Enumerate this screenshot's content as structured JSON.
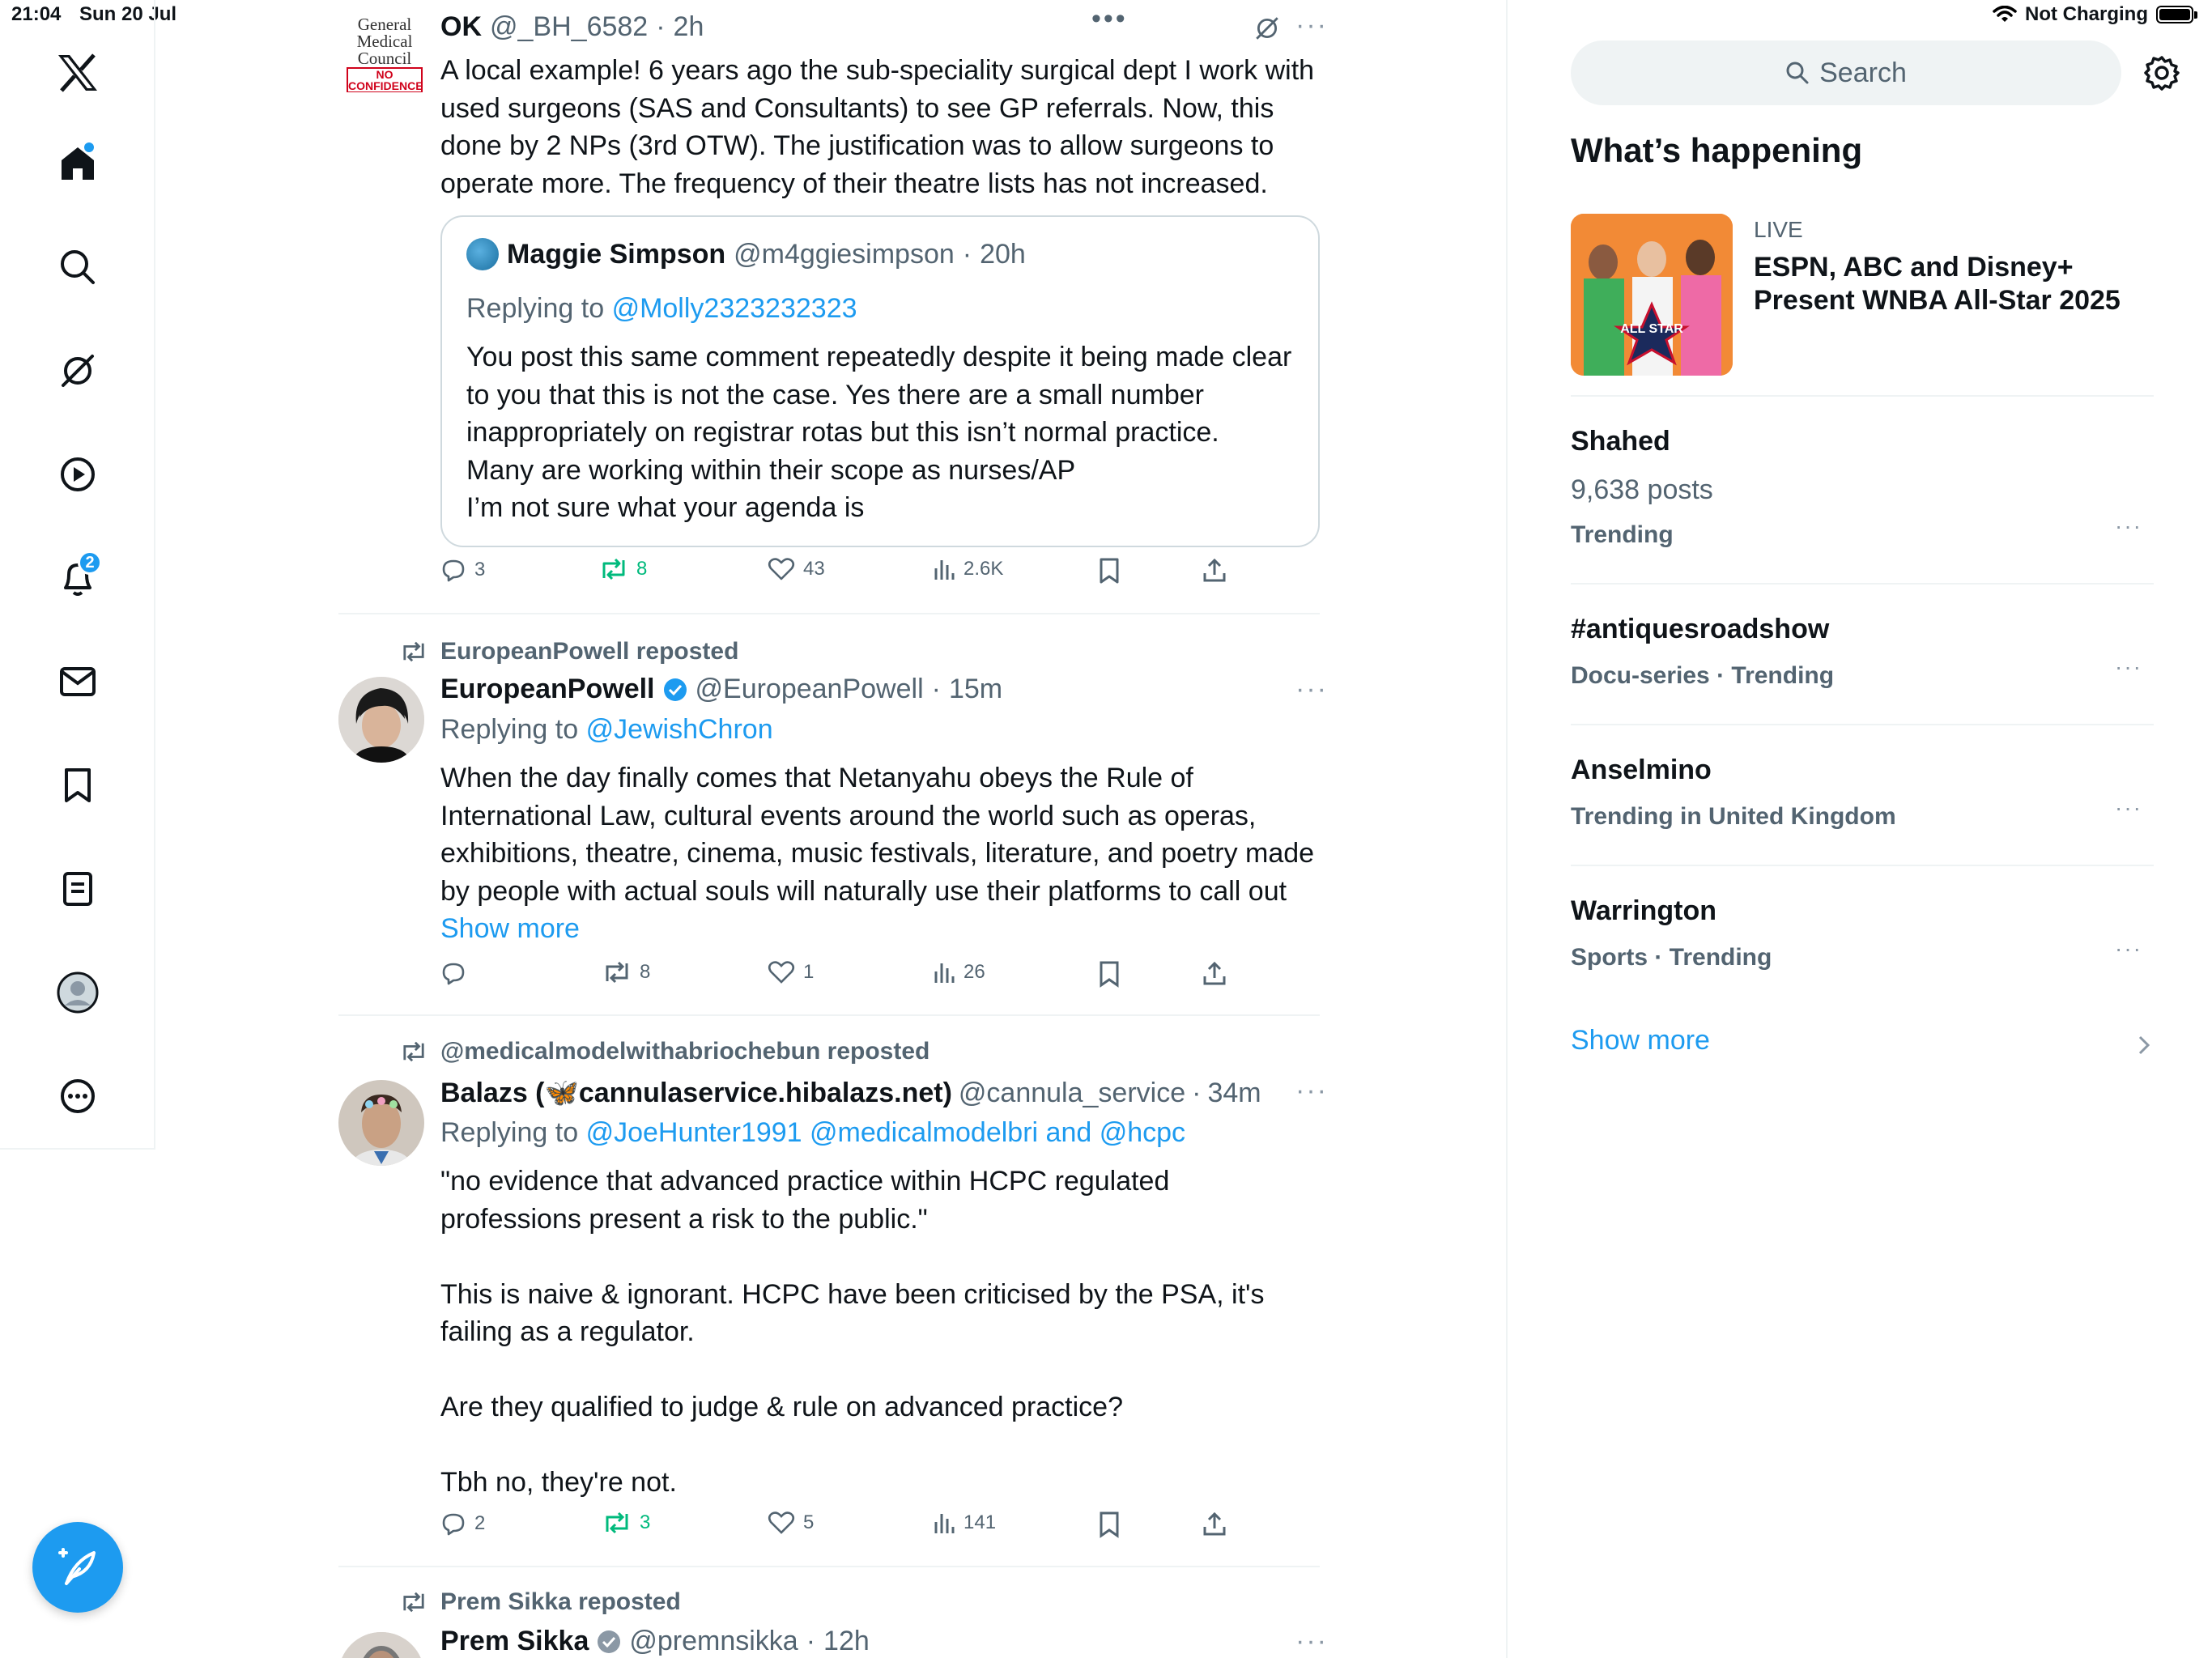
{
  "status_bar": {
    "time": "21:04",
    "date": "Sun 20 Jul",
    "charging": "Not Charging"
  },
  "sidebar": {
    "notifications_badge": "2",
    "items": [
      "x-logo",
      "home",
      "search",
      "grok",
      "videos",
      "notifications",
      "messages",
      "bookmarks",
      "lists",
      "profile",
      "more"
    ]
  },
  "tweets": [
    {
      "name": "OK",
      "handle": "@_BH_6582",
      "time": "2h",
      "avatar_text": {
        "l1": "General",
        "l2": "Medical",
        "l3": "Council",
        "l4": "NO",
        "l5": "CONFIDENCE"
      },
      "text": "A local example! 6 years ago the sub-speciality surgical dept I work with used surgeons (SAS and Consultants) to see GP referrals. Now, this done by 2 NPs (3rd OTW). The justification was to allow surgeons to operate more. The frequency of their theatre lists has not increased.",
      "quote": {
        "name": "Maggie Simpson",
        "handle": "@m4ggiesimpson",
        "time": "20h",
        "replying_prefix": "Replying to",
        "replying_to": "@Molly2323232323",
        "text": "You post this same comment repeatedly despite it being made clear to you that this is not the case. Yes there are a small number inappropriately on registrar rotas but this isn’t normal practice.\nMany are working within their scope as nurses/AP\nI’m not sure what your agenda is"
      },
      "replies": "3",
      "reposts": "8",
      "likes": "43",
      "views": "2.6K"
    },
    {
      "reposted_by": "EuropeanPowell reposted",
      "name": "EuropeanPowell",
      "handle": "@EuropeanPowell",
      "time": "15m",
      "replying_prefix": "Replying to",
      "replying_to": "@JewishChron",
      "text": "When the day finally comes that Netanyahu obeys the Rule of International Law, cultural events around the world such as operas, exhibitions, theatre, cinema, music festivals, literature, and poetry made by people with actual souls will naturally use their platforms to call out",
      "show_more": "Show more",
      "replies": "",
      "reposts": "8",
      "likes": "1",
      "views": "26"
    },
    {
      "reposted_by": "@medicalmodelwithabriochebun reposted",
      "name": "Balazs (🦋cannulaservice.hibalazs.net)",
      "handle": "@cannula_service",
      "time": "34m",
      "replying_prefix": "Replying to",
      "replying_to": "@JoeHunter1991 @medicalmodelbri and @hcpc",
      "text": "\"no evidence that advanced practice within HCPC regulated professions present a risk to the public.\"\n\nThis is naive & ignorant.  HCPC have been criticised by the PSA, it's failing as a regulator.\n\nAre they qualified to judge & rule on advanced practice?\n\nTbh no, they're not.",
      "replies": "2",
      "reposts": "3",
      "likes": "5",
      "views": "141"
    },
    {
      "reposted_by": "Prem Sikka reposted",
      "name": "Prem Sikka",
      "handle": "@premnsikka",
      "time": "12h"
    }
  ],
  "right": {
    "search_placeholder": "Search",
    "title": "What’s happening",
    "live": {
      "label": "LIVE",
      "title": "ESPN, ABC and Disney+ Present WNBA All-Star 2025",
      "image_text": "ALL STAR"
    },
    "trends": [
      {
        "name": "Shahed",
        "count": "9,638 posts",
        "sub": "Trending"
      },
      {
        "name": "#antiquesroadshow",
        "sub": "Docu-series · Trending"
      },
      {
        "name": "Anselmino",
        "sub": "Trending in United Kingdom"
      },
      {
        "name": "Warrington",
        "sub": "Sports · Trending"
      }
    ],
    "show_more": "Show more"
  },
  "colors": {
    "accent": "#1d9bf0",
    "repost": "#00ba7c",
    "muted": "#536471",
    "divider": "#eff3f4"
  }
}
